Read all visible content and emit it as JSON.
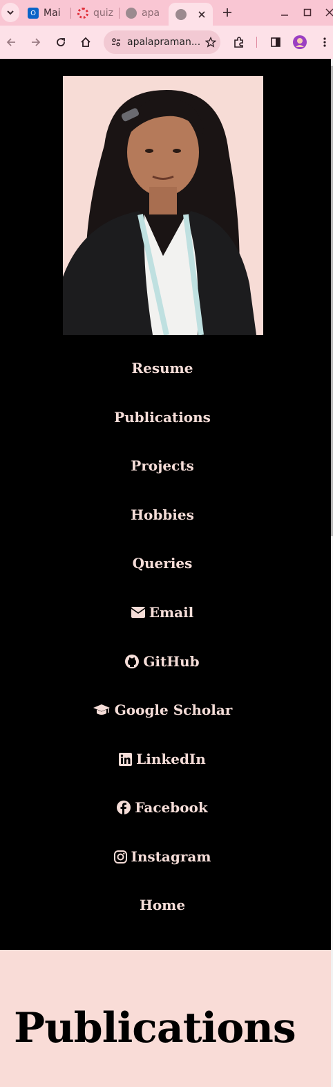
{
  "browser": {
    "tabs": [
      {
        "label": "Mai",
        "favicon": "outlook-icon"
      },
      {
        "label": "quiz",
        "favicon": "quiz-icon"
      },
      {
        "label": "apa",
        "favicon": "globe-icon"
      },
      {
        "label": "",
        "favicon": "globe-icon",
        "active": true
      }
    ],
    "url": "apalapraman...",
    "colors": {
      "tabbar": "#f9c6d3",
      "toolbar": "#fde1e8"
    }
  },
  "nav": {
    "links": [
      {
        "label": "Resume"
      },
      {
        "label": "Publications"
      },
      {
        "label": "Projects"
      },
      {
        "label": "Hobbies"
      },
      {
        "label": "Queries"
      },
      {
        "label": "Email",
        "icon": "envelope-icon"
      },
      {
        "label": "GitHub",
        "icon": "github-icon"
      },
      {
        "label": "Google Scholar",
        "icon": "graduation-cap-icon"
      },
      {
        "label": "LinkedIn",
        "icon": "linkedin-icon"
      },
      {
        "label": "Facebook",
        "icon": "facebook-icon"
      },
      {
        "label": "Instagram",
        "icon": "instagram-icon"
      },
      {
        "label": "Home"
      }
    ]
  },
  "main": {
    "heading": "Publications"
  },
  "colors": {
    "nav_bg": "#000000",
    "nav_text": "#f5ddd8",
    "content_bg": "#f9dcd7",
    "photo_bg": "#f7dcd6"
  }
}
